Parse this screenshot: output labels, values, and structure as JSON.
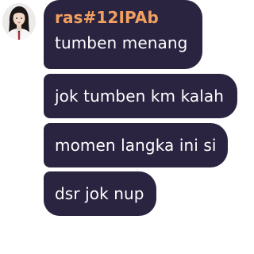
{
  "chat": {
    "sender_name": "ras#12IPAb",
    "avatar_icon": "profile-photo",
    "bubble_color": "#2a2440",
    "name_color": "#f2a060",
    "messages": [
      {
        "text": "tumben menang"
      },
      {
        "text": "jok tumben km kalah"
      },
      {
        "text": "momen langka ini si"
      },
      {
        "text": "dsr jok nup"
      }
    ]
  }
}
